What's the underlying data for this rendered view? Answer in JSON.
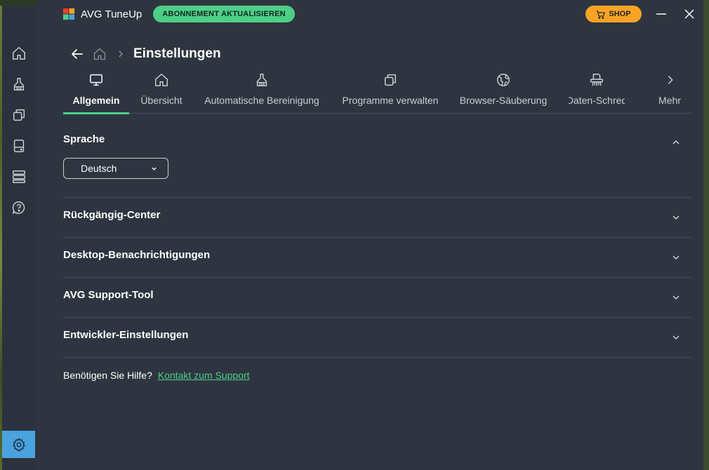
{
  "app": {
    "title": "AVG TuneUp",
    "upgrade_label": "ABONNEMENT AKTUALISIEREN",
    "shop_label": "SHOP"
  },
  "colors": {
    "accent_green": "#4dcf88",
    "shop_orange": "#f7a425",
    "settings_blue": "#4aa3df",
    "window_bg": "#2e3540",
    "sidebar_bg": "#2b323d"
  },
  "sidebar": {
    "items": [
      {
        "icon": "home-icon"
      },
      {
        "icon": "broom-icon"
      },
      {
        "icon": "apps-icon"
      },
      {
        "icon": "drive-icon"
      },
      {
        "icon": "stack-icon"
      },
      {
        "icon": "help-icon"
      }
    ],
    "settings_icon": "gear-icon"
  },
  "breadcrumb": {
    "title": "Einstellungen"
  },
  "tabs": [
    {
      "label": "Allgemein",
      "icon": "monitor-icon",
      "active": true
    },
    {
      "label": "Übersicht",
      "icon": "home-icon",
      "active": false
    },
    {
      "label": "Automatische Bereinigung",
      "icon": "broom-icon",
      "active": false
    },
    {
      "label": "Programme verwalten",
      "icon": "apps-icon",
      "active": false
    },
    {
      "label": "Browser-Säuberung",
      "icon": "globe-icon",
      "active": false
    },
    {
      "label": "Daten-Schred",
      "icon": "shredder-icon",
      "active": false
    },
    {
      "label": "Mehr",
      "icon": "chevron-right-icon",
      "active": false
    }
  ],
  "sections": [
    {
      "title": "Sprache",
      "expanded": true
    },
    {
      "title": "Rückgängig-Center",
      "expanded": false
    },
    {
      "title": "Desktop-Benachrichtigungen",
      "expanded": false
    },
    {
      "title": "AVG Support-Tool",
      "expanded": false
    },
    {
      "title": "Entwickler-Einstellungen",
      "expanded": false
    }
  ],
  "language": {
    "selected": "Deutsch"
  },
  "help": {
    "text": "Benötigen Sie Hilfe?",
    "link": "Kontakt zum Support"
  }
}
